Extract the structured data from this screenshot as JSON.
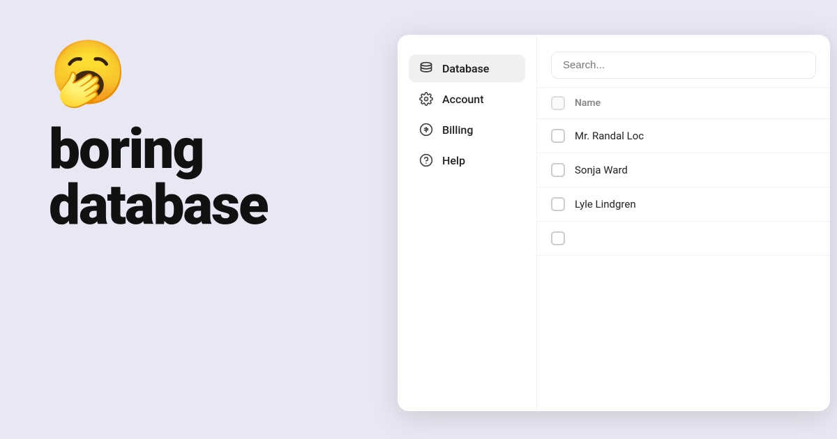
{
  "left": {
    "emoji": "🥱",
    "headline_line1": "boring",
    "headline_line2": "database"
  },
  "sidebar": {
    "items": [
      {
        "id": "database",
        "label": "Database",
        "active": true,
        "icon": "database"
      },
      {
        "id": "account",
        "label": "Account",
        "active": false,
        "icon": "gear"
      },
      {
        "id": "billing",
        "label": "Billing",
        "active": false,
        "icon": "dollar"
      },
      {
        "id": "help",
        "label": "Help",
        "active": false,
        "icon": "question"
      }
    ]
  },
  "search": {
    "placeholder": "Search..."
  },
  "table": {
    "header": {
      "name_col": "Name"
    },
    "rows": [
      {
        "name": "Mr. Randal Loc"
      },
      {
        "name": "Sonja Ward"
      },
      {
        "name": "Lyle Lindgren"
      }
    ]
  }
}
